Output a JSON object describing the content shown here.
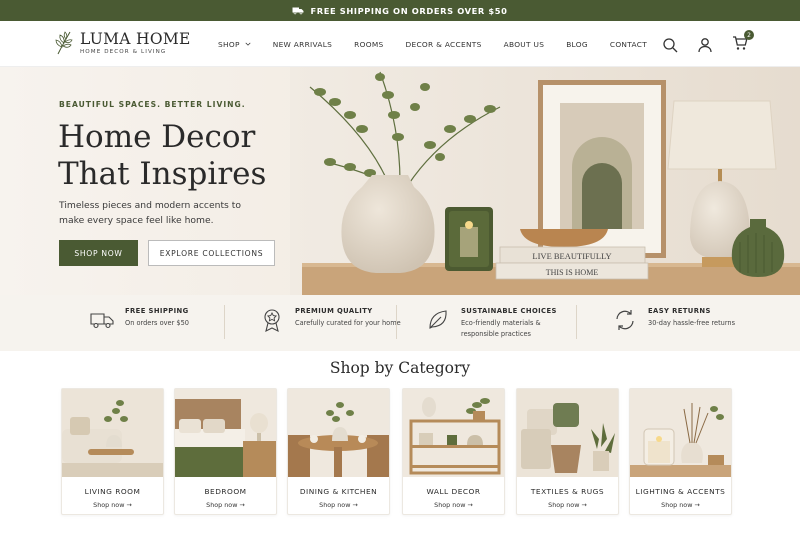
{
  "announcement": {
    "text": "FREE SHIPPING ON ORDERS OVER $50",
    "icon": "truck-icon"
  },
  "header": {
    "brand": "LUMA HOME",
    "tagline": "HOME DECOR & LIVING",
    "nav": [
      {
        "label": "SHOP",
        "has_dropdown": true
      },
      {
        "label": "NEW ARRIVALS"
      },
      {
        "label": "ROOMS"
      },
      {
        "label": "DECOR & ACCENTS"
      },
      {
        "label": "ABOUT US"
      },
      {
        "label": "BLOG"
      },
      {
        "label": "CONTACT"
      }
    ],
    "icons": [
      "search-icon",
      "user-icon",
      "cart-icon"
    ],
    "cart_count": "2"
  },
  "hero": {
    "eyebrow": "BEAUTIFUL SPACES. BETTER LIVING.",
    "title": "Home Decor That Inspires",
    "subtitle": "Timeless pieces and modern accents to make every space feel like home.",
    "primary_cta": "SHOP NOW",
    "secondary_cta": "EXPLORE COLLECTIONS",
    "book_1": "LIVE BEAUTIFULLY",
    "book_2": "THIS IS HOME"
  },
  "features": [
    {
      "icon": "truck-icon",
      "title": "FREE SHIPPING",
      "text": "On orders over $50"
    },
    {
      "icon": "badge-icon",
      "title": "PREMIUM QUALITY",
      "text": "Carefully curated for your home"
    },
    {
      "icon": "leaf-icon",
      "title": "SUSTAINABLE CHOICES",
      "text": "Eco-friendly materials & responsible practices"
    },
    {
      "icon": "returns-icon",
      "title": "EASY RETURNS",
      "text": "30-day hassle-free returns"
    }
  ],
  "categories": {
    "heading": "Shop by Category",
    "link_label": "Shop now →",
    "items": [
      {
        "name": "LIVING ROOM"
      },
      {
        "name": "BEDROOM"
      },
      {
        "name": "DINING & KITCHEN"
      },
      {
        "name": "WALL DECOR"
      },
      {
        "name": "TEXTILES & RUGS"
      },
      {
        "name": "LIGHTING & ACCENTS"
      }
    ]
  },
  "colors": {
    "accent": "#4a5a33",
    "hero_bg": "#f3ede5",
    "feature_bg": "#f6f3ee"
  }
}
